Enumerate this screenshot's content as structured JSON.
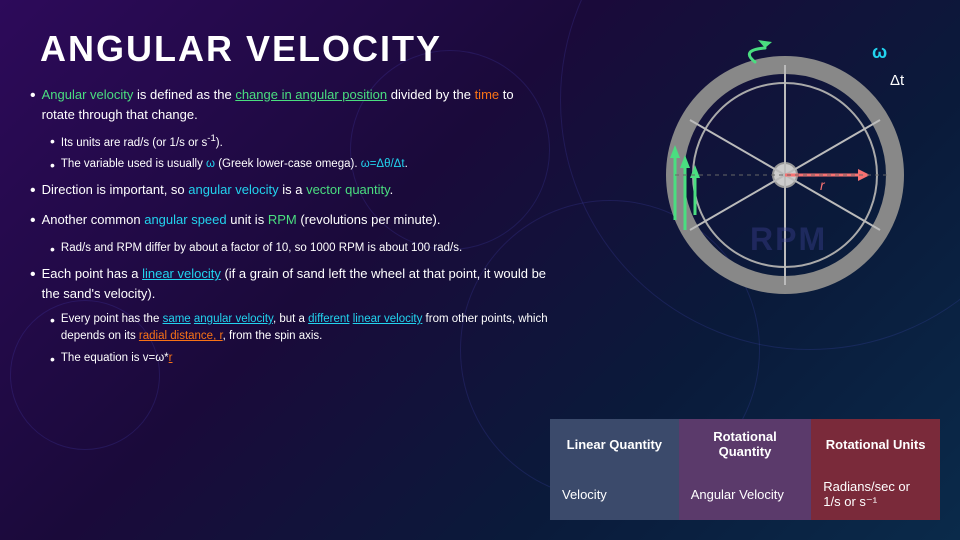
{
  "title": "ANGULAR VELOCITY",
  "bullets": [
    {
      "id": "b1",
      "text_parts": [
        {
          "text": "Angular velocity",
          "style": "highlight-green"
        },
        {
          "text": " is defined as the "
        },
        {
          "text": "change in angular position",
          "style": "underline-green"
        },
        {
          "text": " divided by the "
        },
        {
          "text": "time",
          "style": "highlight-orange"
        },
        {
          "text": " to rotate through that change."
        }
      ],
      "sub": [
        {
          "id": "s1",
          "text_parts": [
            {
              "text": "Its units are rad/s (or 1/s or s"
            },
            {
              "text": "-1",
              "sup": true
            },
            {
              "text": ")."
            }
          ]
        },
        {
          "id": "s2",
          "text_parts": [
            {
              "text": "The variable used is usually "
            },
            {
              "text": "ω",
              "style": "highlight-cyan"
            },
            {
              "text": " (Greek lower-case omega). "
            },
            {
              "text": "ω=Δθ/Δt",
              "style": "highlight-cyan"
            },
            {
              "text": "."
            }
          ]
        }
      ]
    },
    {
      "id": "b2",
      "text_parts": [
        {
          "text": "Direction is important, so "
        },
        {
          "text": "angular velocity",
          "style": "highlight-cyan"
        },
        {
          "text": " is a "
        },
        {
          "text": "vector quantity",
          "style": "highlight-green"
        },
        {
          "text": "."
        }
      ],
      "sub": []
    },
    {
      "id": "b3",
      "text_parts": [
        {
          "text": "Another common "
        },
        {
          "text": "angular speed",
          "style": "highlight-cyan"
        },
        {
          "text": " unit is "
        },
        {
          "text": "RPM",
          "style": "highlight-green"
        },
        {
          "text": " (revolutions per minute)."
        }
      ],
      "sub": [
        {
          "id": "s3",
          "text_parts": [
            {
              "text": "Rad/s and RPM differ by about a factor of 10, so 1000 RPM is about 100 rad/s."
            }
          ]
        }
      ]
    },
    {
      "id": "b4",
      "text_parts": [
        {
          "text": "Each point has a "
        },
        {
          "text": "linear velocity",
          "style": "underline-cyan"
        },
        {
          "text": " (if a grain of sand left the wheel at that point, it would be the sand's velocity)."
        }
      ],
      "sub": [
        {
          "id": "s4",
          "text_parts": [
            {
              "text": "Every point has the "
            },
            {
              "text": "same",
              "style": "underline-cyan"
            },
            {
              "text": " "
            },
            {
              "text": "angular velocity",
              "style": "underline-cyan"
            },
            {
              "text": ", but a "
            },
            {
              "text": "different",
              "style": "underline-cyan"
            },
            {
              "text": " "
            },
            {
              "text": "linear velocity",
              "style": "underline-cyan"
            },
            {
              "text": " from other points, which depends on its "
            },
            {
              "text": "radial distance, r",
              "style": "underline-orange"
            },
            {
              "text": ", from the spin axis."
            }
          ]
        },
        {
          "id": "s5",
          "text_parts": [
            {
              "text": "The equation is v=ω*"
            },
            {
              "text": "r",
              "style": "underline-orange"
            }
          ]
        }
      ]
    }
  ],
  "table": {
    "headers": [
      {
        "id": "h1",
        "text": "Linear Quantity",
        "col": "linear"
      },
      {
        "id": "h2",
        "text": "Rotational Quantity",
        "col": "rotational-qty"
      },
      {
        "id": "h3",
        "text": "Rotational Units",
        "col": "rotational-units"
      }
    ],
    "rows": [
      {
        "id": "r1",
        "cells": [
          {
            "col": "linear",
            "text": "Velocity"
          },
          {
            "col": "rotational-qty",
            "text": "Angular Velocity"
          },
          {
            "col": "rotational-units",
            "text": "Radians/sec or 1/s or s⁻¹"
          }
        ]
      }
    ]
  },
  "wheel": {
    "omega_label": "ω",
    "delta_t_label": "Δt",
    "rpm_bg": "RPM"
  }
}
